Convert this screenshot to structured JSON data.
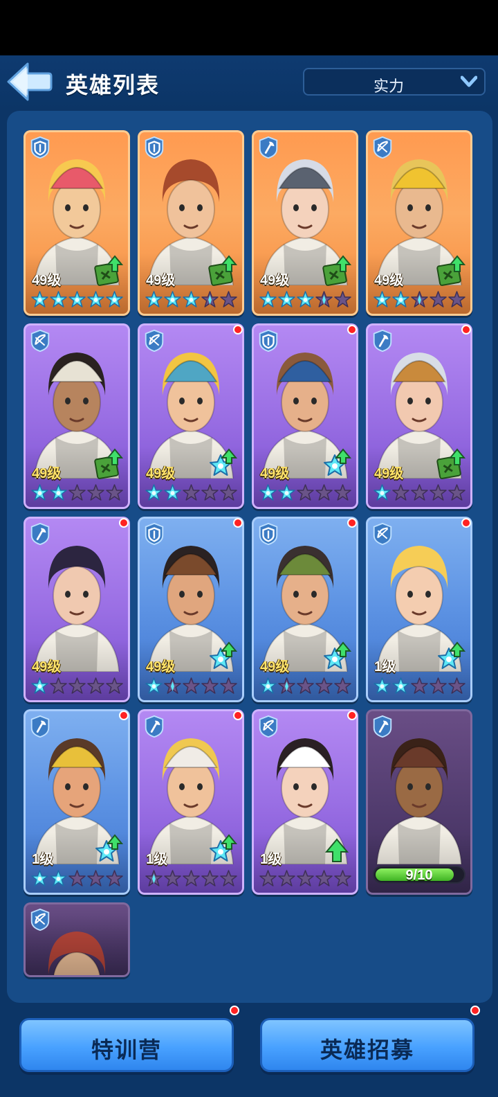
{
  "header": {
    "title": "英雄列表",
    "sort": {
      "selected": "实力"
    }
  },
  "heroes": [
    {
      "level": "49级",
      "bg": "orange",
      "role": "shield",
      "stars": {
        "full": 5,
        "half": 0
      },
      "upgrade": "book",
      "dot": false,
      "skin": "#f2c99a",
      "hair": "#f7c950",
      "hat": "#e85a6a"
    },
    {
      "level": "49级",
      "bg": "orange",
      "role": "shield",
      "stars": {
        "full": 3,
        "half": 1
      },
      "upgrade": "book",
      "dot": false,
      "skin": "#f0c29b",
      "hair": "#a64a2c",
      "hat": ""
    },
    {
      "level": "49级",
      "bg": "orange",
      "role": "axe",
      "stars": {
        "full": 3,
        "half": 1
      },
      "upgrade": "book",
      "dot": false,
      "skin": "#f4d2bc",
      "hair": "#d6dbe6",
      "hat": "#5a6270"
    },
    {
      "level": "49级",
      "bg": "orange",
      "role": "bow",
      "stars": {
        "full": 2,
        "half": 1
      },
      "upgrade": "book",
      "dot": false,
      "skin": "#e9b98f",
      "hair": "#e8c55a",
      "hat": "#f0c330"
    },
    {
      "level": "49级",
      "bg": "purple",
      "role": "bow",
      "stars": {
        "full": 2,
        "half": 0
      },
      "upgrade": "book",
      "dot": false,
      "skin": "#b7845e",
      "hair": "#2a2220",
      "hat": "#e7e2d4"
    },
    {
      "level": "49级",
      "bg": "purple",
      "role": "bow",
      "stars": {
        "full": 2,
        "half": 0
      },
      "upgrade": "star",
      "dot": true,
      "skin": "#f0c29b",
      "hair": "#f2c542",
      "hat": "#4fa6c4"
    },
    {
      "level": "49级",
      "bg": "purple",
      "role": "shield",
      "stars": {
        "full": 2,
        "half": 0
      },
      "upgrade": "star",
      "dot": true,
      "skin": "#e6b08a",
      "hair": "#8a5a3c",
      "hat": "#2f5fa0"
    },
    {
      "level": "49级",
      "bg": "purple",
      "role": "axe",
      "stars": {
        "full": 1,
        "half": 0
      },
      "upgrade": "book",
      "dot": true,
      "skin": "#f2c9b0",
      "hair": "#d8dde6",
      "hat": "#c98a3c"
    },
    {
      "level": "49级",
      "bg": "purple",
      "role": "axe",
      "stars": {
        "full": 1,
        "half": 0
      },
      "upgrade": "",
      "dot": true,
      "skin": "#f0c9b0",
      "hair": "#2c2540",
      "hat": ""
    },
    {
      "level": "49级",
      "bg": "blue",
      "role": "shield",
      "stars": {
        "full": 1,
        "half": 1
      },
      "upgrade": "star",
      "dot": true,
      "skin": "#e0a67e",
      "hair": "#2a2222",
      "hat": "#7a4a2c"
    },
    {
      "level": "49级",
      "bg": "blue",
      "role": "shield",
      "stars": {
        "full": 1,
        "half": 1
      },
      "upgrade": "star",
      "dot": true,
      "skin": "#e6b08a",
      "hair": "#3a3030",
      "hat": "#6c8a3a"
    },
    {
      "level": "1级",
      "bg": "blue",
      "role": "bow",
      "stars": {
        "full": 2,
        "half": 0
      },
      "upgrade": "star",
      "dot": true,
      "skin": "#f4cdb0",
      "hair": "#f6cd56",
      "hat": ""
    },
    {
      "level": "1级",
      "bg": "blue",
      "role": "axe",
      "stars": {
        "full": 2,
        "half": 0
      },
      "upgrade": "star",
      "dot": true,
      "skin": "#e6a47a",
      "hair": "#5a3a28",
      "hat": "#e8c03a"
    },
    {
      "level": "1级",
      "bg": "purple",
      "role": "axe",
      "stars": {
        "full": 0,
        "half": 1
      },
      "upgrade": "star",
      "dot": true,
      "skin": "#f0c29b",
      "hair": "#f0c850",
      "hat": "#f0ece6"
    },
    {
      "level": "1级",
      "bg": "purple",
      "role": "bow",
      "stars": {
        "full": 0,
        "half": 0
      },
      "upgrade": "arrow",
      "dot": true,
      "skin": "#f4d2bc",
      "hair": "#2a2024",
      "hat": "#ffffff"
    },
    {
      "level": "",
      "bg": "dark",
      "role": "axe",
      "stars": null,
      "upgrade": "",
      "dot": false,
      "skin": "#9a6a44",
      "hair": "#3a2218",
      "hat": "#6a3a2a",
      "progress": {
        "text": "9/10",
        "value": 0.9
      }
    },
    {
      "level": "",
      "bg": "dark",
      "role": "bow",
      "stars": null,
      "upgrade": "",
      "dot": false,
      "skin": "#f0c29b",
      "hair": "#b8463a",
      "hat": "",
      "partial": true
    }
  ],
  "buttons": {
    "training": "特训营",
    "recruit": "英雄招募"
  },
  "colors": {
    "background": "#0c3566",
    "panel": "#174c88",
    "gold_level": "#ffe46a",
    "star_active": "#5ee8f6",
    "star_inactive": "#6a5488",
    "button": "#48a1ff",
    "red_dot": "#ff2222"
  }
}
